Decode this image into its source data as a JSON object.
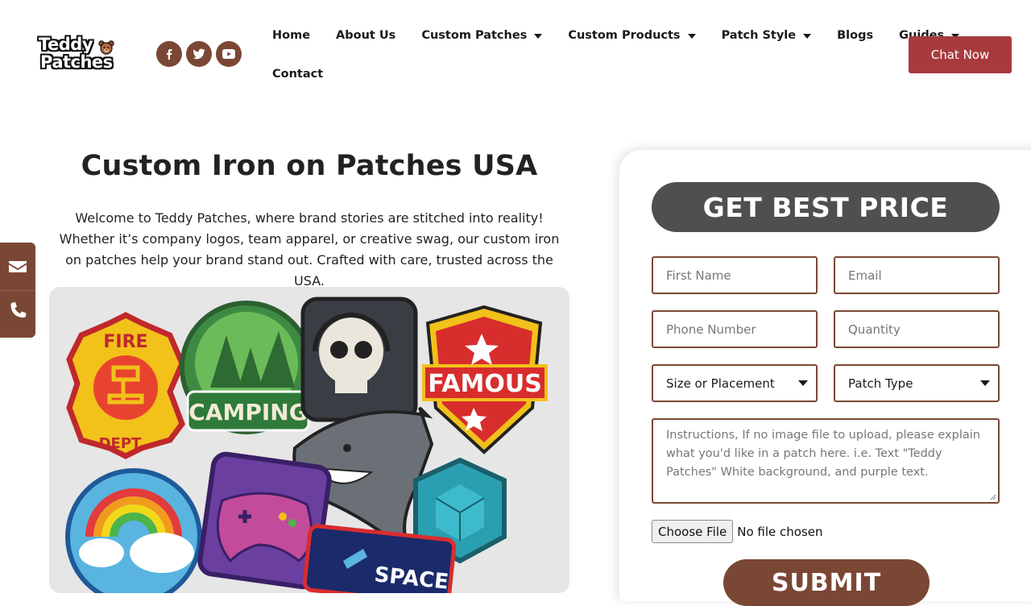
{
  "brand": {
    "logo_line1": "Teddy",
    "logo_line2": "Patches",
    "accent_color": "#7b4735",
    "cta_color": "#a83a3e",
    "heading_bg": "#4f4f4f"
  },
  "social": [
    {
      "name": "facebook-icon",
      "glyph": "f"
    },
    {
      "name": "twitter-icon",
      "glyph": "twitter"
    },
    {
      "name": "youtube-icon",
      "glyph": "youtube"
    }
  ],
  "nav": {
    "items": [
      {
        "label": "Home",
        "dropdown": false
      },
      {
        "label": "About Us",
        "dropdown": false
      },
      {
        "label": "Custom Patches",
        "dropdown": true
      },
      {
        "label": "Custom Products",
        "dropdown": true
      },
      {
        "label": "Patch Style",
        "dropdown": true
      },
      {
        "label": "Blogs",
        "dropdown": false
      },
      {
        "label": "Guides",
        "dropdown": true
      },
      {
        "label": "Contact",
        "dropdown": false
      }
    ],
    "chat_label": "Chat Now"
  },
  "float_contact": {
    "icons": [
      "envelope-icon",
      "phone-icon"
    ]
  },
  "hero": {
    "title": "Custom Iron on Patches USA",
    "description": "Welcome to Teddy Patches, where brand stories are stitched into reality! Whether it’s company logos, team apparel, or creative swag, our custom iron on patches help your brand stand out. Crafted with care, trusted across the USA.",
    "image_labels": {
      "fire_top": "FIRE",
      "fire_bottom": "DEPT.",
      "camping": "CAMPING",
      "famous": "FAMOUS",
      "space": "SPACE"
    }
  },
  "form": {
    "heading": "GET BEST PRICE",
    "first_name_placeholder": "First Name",
    "email_placeholder": "Email",
    "phone_placeholder": "Phone Number",
    "quantity_placeholder": "Quantity",
    "size_select": "Size or Placement",
    "patch_type_select": "Patch Type",
    "instructions_placeholder": "Instructions, If no image file to upload, please explain what you'd like in a patch here. i.e. Text \"Teddy Patches\" White background, and purple text.",
    "file_button": "Choose File",
    "file_status": "No file chosen",
    "submit_label": "SUBMIT"
  }
}
